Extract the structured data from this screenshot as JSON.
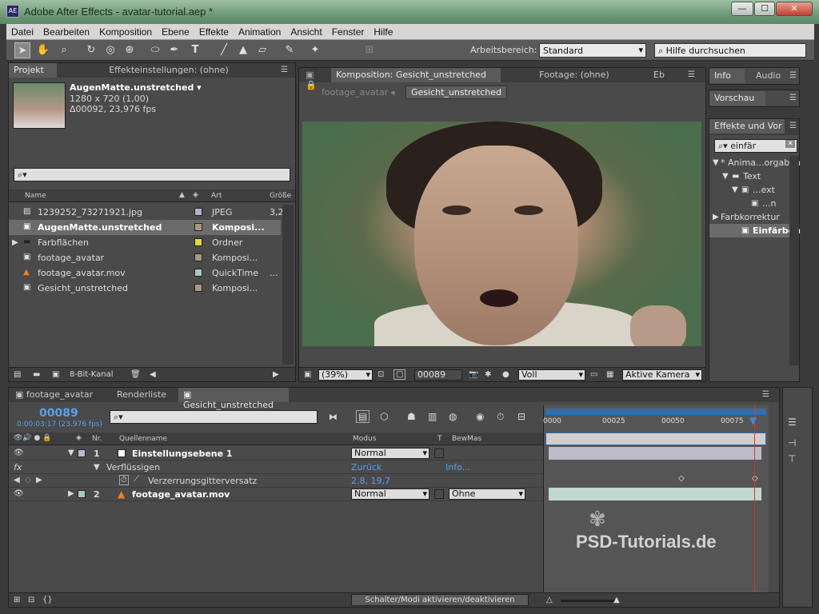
{
  "window": {
    "title": "Adobe After Effects - avatar-tutorial.aep *",
    "app_icon": "AE",
    "min": "—",
    "max": "☐",
    "close": "✕"
  },
  "menu": [
    "Datei",
    "Bearbeiten",
    "Komposition",
    "Ebene",
    "Effekte",
    "Animation",
    "Ansicht",
    "Fenster",
    "Hilfe"
  ],
  "toolbar": {
    "workspace_label": "Arbeitsbereich:",
    "workspace_value": "Standard",
    "help_placeholder": "Hilfe durchsuchen"
  },
  "project_panel": {
    "tabs": [
      "Projekt",
      "Effekteinstellungen: (ohne)"
    ],
    "selected_name": "AugenMatte.unstretched ▾",
    "selected_info1": "1280 x 720 (1,00)",
    "selected_info2": "Δ00092, 23,976 fps",
    "search_placeholder": "⌕▾",
    "columns": {
      "name": "Name",
      "art": "Art",
      "size": "Größe"
    },
    "items": [
      {
        "name": "1239252_73271921.jpg",
        "type": "JPEG",
        "size": "3,2",
        "color": "#b8b0c8",
        "icon": "image-icon"
      },
      {
        "name": "AugenMatte.unstretched",
        "type": "Komposi...",
        "size": "",
        "color": "#a89880",
        "icon": "composition-icon",
        "selected": true
      },
      {
        "name": "Farbflächen",
        "type": "Ordner",
        "size": "",
        "color": "#e0d840",
        "icon": "folder-icon"
      },
      {
        "name": "footage_avatar",
        "type": "Komposi...",
        "size": "",
        "color": "#a89880",
        "icon": "composition-icon"
      },
      {
        "name": "footage_avatar.mov",
        "type": "QuickTime",
        "size": "...",
        "color": "#a8c8c0",
        "icon": "quicktime-icon"
      },
      {
        "name": "Gesicht_unstretched",
        "type": "Komposi...",
        "size": "",
        "color": "#a89880",
        "icon": "composition-icon"
      }
    ],
    "footer_bits": "8-Bit-Kanal"
  },
  "comp_panel": {
    "tabs": [
      "Komposition: Gesicht_unstretched",
      "Footage: (ohne)",
      "Eb"
    ],
    "breadcrumbs": [
      "footage_avatar",
      "Gesicht_unstretched"
    ],
    "zoom": "(39%)",
    "timecode": "00089",
    "resolution": "Voll",
    "camera": "Aktive Kamera"
  },
  "right_panels": {
    "info_tabs": [
      "Info",
      "Audio"
    ],
    "preview_tab": "Vorschau",
    "effects_tab": "Effekte und Vor",
    "search_value": "einfär",
    "tree": [
      {
        "label": "* Anima...orgaben",
        "indent": 0
      },
      {
        "label": "Text",
        "indent": 1
      },
      {
        "label": "...ext",
        "indent": 2
      },
      {
        "label": "...n",
        "indent": 3
      },
      {
        "label": "Farbkorrektur",
        "indent": 0
      },
      {
        "label": "Einfärben",
        "indent": 2,
        "selected": true
      }
    ]
  },
  "timeline": {
    "tabs": [
      "footage_avatar",
      "Renderliste",
      "Gesicht_unstretched"
    ],
    "current_time": "00089",
    "time_sub": "0:00:03:17 (23.976 fps)",
    "search_placeholder": "⌕▾",
    "columns": {
      "nr": "Nr.",
      "source": "Quellenname",
      "mode": "Modus",
      "t": "T",
      "trkmat": "BewMas"
    },
    "ruler": [
      "0000",
      "00025",
      "00050",
      "00075"
    ],
    "layers": [
      {
        "nr": "1",
        "name": "Einstellungsebene 1",
        "mode": "Normal"
      },
      {
        "effect": "Verflüssigen",
        "reset": "Zurück",
        "info": "Info..."
      },
      {
        "property": "Verzerrungsgitterversatz",
        "value": "2,8, 19,7"
      },
      {
        "nr": "2",
        "name": "footage_avatar.mov",
        "mode": "Normal",
        "trkmat": "Ohne"
      }
    ],
    "footer_toggle": "Schalter/Modi aktivieren/deaktivieren"
  },
  "watermark": "PSD-Tutorials.de"
}
